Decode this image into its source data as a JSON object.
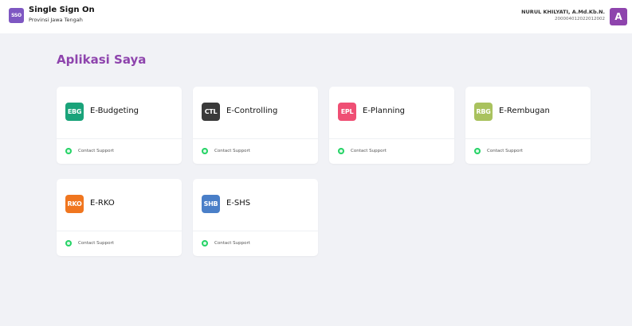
{
  "header": {
    "logo_text": "SSO",
    "title": "Single Sign On",
    "subtitle": "Provinsi Jawa Tengah",
    "user_name": "NURUL KHILYATI, A.Md.Kb.N.",
    "user_id": "200004012022012002",
    "avatar_initial": "A"
  },
  "main": {
    "section_title": "Aplikasi Saya",
    "apps": [
      {
        "icon_text": "EBG",
        "name": "E-Budgeting",
        "support": "Contact Support",
        "color": "#1aa37a"
      },
      {
        "icon_text": "CTL",
        "name": "E-Controlling",
        "support": "Contact Support",
        "color": "#3a3a3a"
      },
      {
        "icon_text": "EPL",
        "name": "E-Planning",
        "support": "Contact Support",
        "color": "#ef4f74"
      },
      {
        "icon_text": "RBG",
        "name": "E-Rembugan",
        "support": "Contact Support",
        "color": "#a9c25e"
      },
      {
        "icon_text": "RKO",
        "name": "E-RKO",
        "support": "Contact Support",
        "color": "#f0761f"
      },
      {
        "icon_text": "SHB",
        "name": "E-SHS",
        "support": "Contact Support",
        "color": "#4a7fc8"
      }
    ]
  },
  "colors": {
    "accent": "#8e44ad",
    "background": "#f1f2f6",
    "support_icon": "#25d366"
  }
}
